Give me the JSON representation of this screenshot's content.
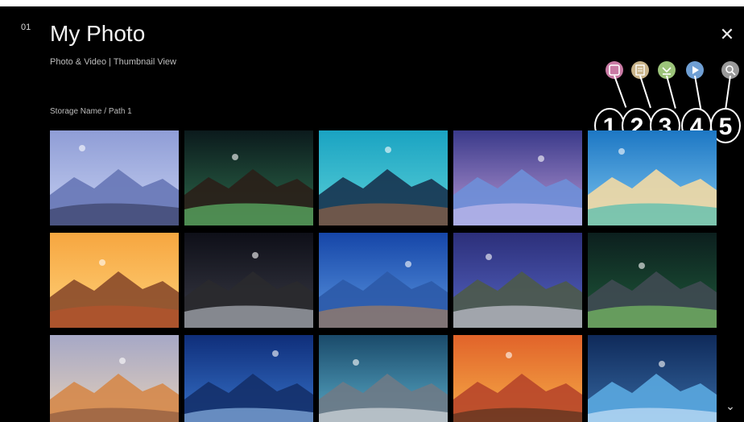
{
  "header": {
    "corner_label": "01",
    "title": "My Photo",
    "subtitle": "Photo & Video  |  Thumbnail View",
    "close_glyph": "✕"
  },
  "breadcrumb": "Storage Name  /  Path 1",
  "toolbar": {
    "buttons": [
      {
        "name": "select-mode-icon",
        "callout": "1",
        "color": "#c97aa4"
      },
      {
        "name": "list-view-icon",
        "callout": "2",
        "color": "#c9b48a"
      },
      {
        "name": "sort-icon",
        "callout": "3",
        "color": "#9cc47a"
      },
      {
        "name": "play-icon",
        "callout": "4",
        "color": "#6f9fd4"
      },
      {
        "name": "search-icon",
        "callout": "5",
        "color": "#9a9a9a"
      }
    ]
  },
  "photos": [
    {
      "name": "photo-seaside-cliff",
      "sky": [
        "#8f9dd6",
        "#c6d0f1"
      ],
      "ground": "#6777b6",
      "accent": "#2c3050"
    },
    {
      "name": "photo-aurora-lighthouse",
      "sky": [
        "#0b1a1c",
        "#2e6b4b"
      ],
      "ground": "#2a1f18",
      "accent": "#6be07e"
    },
    {
      "name": "photo-teal-mountain",
      "sky": [
        "#1aa3c2",
        "#5cd1d8"
      ],
      "ground": "#17334f",
      "accent": "#b06a3e"
    },
    {
      "name": "photo-purple-shore",
      "sky": [
        "#3a3a8a",
        "#b99ad6"
      ],
      "ground": "#6e8fd8",
      "accent": "#d9c6f0"
    },
    {
      "name": "photo-tropical-beach",
      "sky": [
        "#1d77c4",
        "#7ec6ef"
      ],
      "ground": "#f2d9a4",
      "accent": "#26b6b0"
    },
    {
      "name": "photo-rock-arch",
      "sky": [
        "#f6a640",
        "#ffd27a"
      ],
      "ground": "#8a4a2a",
      "accent": "#c0522a"
    },
    {
      "name": "photo-moon-desert-tent",
      "sky": [
        "#0e0f18",
        "#3a3b46"
      ],
      "ground": "#2a2a2e",
      "accent": "#cfd6df"
    },
    {
      "name": "photo-blue-mountains",
      "sky": [
        "#1646a8",
        "#5a96e0"
      ],
      "ground": "#2c5aa8",
      "accent": "#c2874a"
    },
    {
      "name": "photo-crescent-moon",
      "sky": [
        "#2c2f7a",
        "#5565c2"
      ],
      "ground": "#4d5a4a",
      "accent": "#e7e4f4"
    },
    {
      "name": "photo-green-aurora",
      "sky": [
        "#0c1f1e",
        "#1f5a3a"
      ],
      "ground": "#3f4a52",
      "accent": "#8be06a"
    },
    {
      "name": "photo-paraglider-dunes",
      "sky": [
        "#a6a8c6",
        "#e8d2b8"
      ],
      "ground": "#d5884a",
      "accent": "#7a4c3a"
    },
    {
      "name": "photo-night-valley",
      "sky": [
        "#0f2e7a",
        "#3a78d0"
      ],
      "ground": "#14306a",
      "accent": "#a9d4ff"
    },
    {
      "name": "photo-aurora-snow-peaks",
      "sky": [
        "#1a4a6a",
        "#5fb3d0"
      ],
      "ground": "#6e7a86",
      "accent": "#f2f4f6"
    },
    {
      "name": "photo-cactus-sunset",
      "sky": [
        "#e1632a",
        "#f8b24a"
      ],
      "ground": "#b7462a",
      "accent": "#3a2a1c"
    },
    {
      "name": "photo-moon-ice-cave",
      "sky": [
        "#0f2a5a",
        "#3a6ea8"
      ],
      "ground": "#5aa8e0",
      "accent": "#e8f2ff"
    }
  ],
  "scroll_glyph": "⌄"
}
